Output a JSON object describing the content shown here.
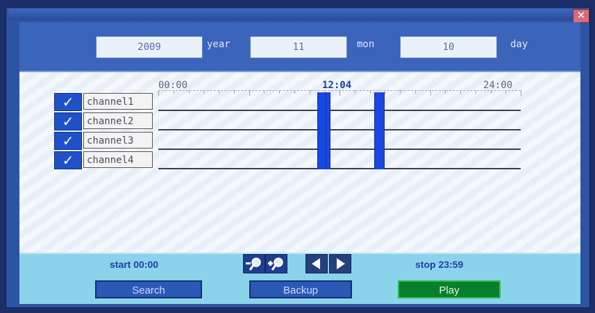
{
  "window": {
    "close_symbol": "✕",
    "close_icon": "close-icon"
  },
  "date": {
    "year_value": "2009",
    "year_label": "year",
    "month_value": "11",
    "month_label": "mon",
    "day_value": "10",
    "day_label": "day"
  },
  "timeline": {
    "start_label": "00:00",
    "current_label": "12:04",
    "end_label": "24:00",
    "record_color": "#1848e0",
    "record_blocks": [
      {
        "start_hour": 10.55,
        "end_hour": 11.05
      },
      {
        "start_hour": 11.1,
        "end_hour": 11.3
      },
      {
        "start_hour": 14.3,
        "end_hour": 14.9
      }
    ]
  },
  "channels": [
    {
      "label": "channel1",
      "checked": true,
      "check_mark": "✓"
    },
    {
      "label": "channel2",
      "checked": true,
      "check_mark": "✓"
    },
    {
      "label": "channel3",
      "checked": true,
      "check_mark": "✓"
    },
    {
      "label": "channel4",
      "checked": true,
      "check_mark": "✓"
    }
  ],
  "controls": {
    "start_text": "start 00:00",
    "stop_text": "stop 23:59",
    "zoom_out_icon": "zoom-out-icon",
    "zoom_in_icon": "zoom-in-icon",
    "prev_icon": "arrow-left-icon",
    "next_icon": "arrow-right-icon",
    "search_label": "Search",
    "backup_label": "Backup",
    "play_label": "Play"
  },
  "colors": {
    "accent_blue": "#2f53a3",
    "play_green": "#0a7f2b",
    "check_blue": "#1f52c9"
  }
}
